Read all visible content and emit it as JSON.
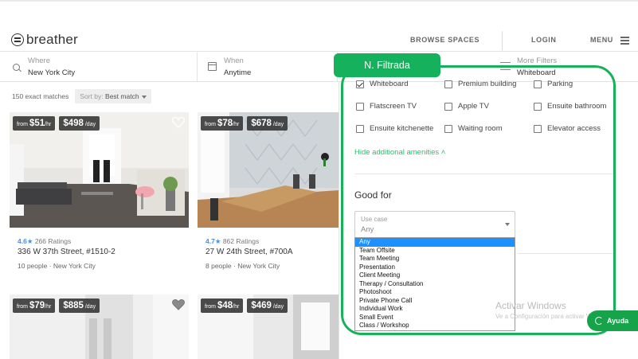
{
  "header": {
    "logo": "breather",
    "nav": [
      "BROWSE SPACES",
      "LOGIN",
      "MENU"
    ]
  },
  "filters": {
    "where_label": "Where",
    "where_value": "New York City",
    "when_label": "When",
    "when_value": "Anytime",
    "more_label": "More Filters",
    "more_value": "Whiteboard"
  },
  "results": {
    "count": "150 exact matches",
    "sort_label": "Sort by:",
    "sort_value": "Best match",
    "cards": [
      {
        "from": "from",
        "hourly": "$51",
        "hourly_unit": "/hr",
        "daily": "$498",
        "daily_unit": "/day",
        "rating": "4.6",
        "ratings": "266 Ratings",
        "address": "336 W 37th Street, #1510-2",
        "people": "10 people",
        "city": "New York City"
      },
      {
        "from": "from",
        "hourly": "$78",
        "hourly_unit": "/hr",
        "daily": "$678",
        "daily_unit": "/day",
        "rating": "4.7",
        "ratings": "862 Ratings",
        "address": "27 W 24th Street, #700A",
        "people": "8 people",
        "city": "New York City"
      },
      {
        "from": "from",
        "hourly": "$79",
        "hourly_unit": "/hr",
        "daily": "$885",
        "daily_unit": "/day"
      },
      {
        "from": "from",
        "hourly": "$48",
        "hourly_unit": "/hr",
        "daily": "$469",
        "daily_unit": "/day"
      }
    ]
  },
  "amenities": [
    {
      "label": "Whiteboard",
      "checked": true
    },
    {
      "label": "Premium building",
      "checked": false
    },
    {
      "label": "Parking",
      "checked": false
    },
    {
      "label": "Flatscreen TV",
      "checked": false
    },
    {
      "label": "Apple TV",
      "checked": false
    },
    {
      "label": "Ensuite bathroom",
      "checked": false
    },
    {
      "label": "Ensuite kitchenette",
      "checked": false
    },
    {
      "label": "Waiting room",
      "checked": false
    },
    {
      "label": "Elevator access",
      "checked": false
    }
  ],
  "hide_amenities": "Hide additional amenities",
  "good_for": {
    "heading": "Good for",
    "select_label": "Use case",
    "select_value": "Any",
    "options": [
      "Any",
      "Team Offsite",
      "Team Meeting",
      "Presentation",
      "Client Meeting",
      "Therapy / Consultation",
      "Photoshoot",
      "Private Phone Call",
      "Individual Work",
      "Small Event",
      "Class / Workshop"
    ],
    "selected_option": "Any"
  },
  "overlay": {
    "annotation": "N. Filtrada",
    "watermark_title": "Activar Windows",
    "watermark_sub": "Ve a Configuración para activar Windows.",
    "help": "Ayuda"
  },
  "colors": {
    "accent_green": "#2dbb6c",
    "annotation_green": "#16b15c",
    "rating_blue": "#4a90e2",
    "option_highlight": "#1e90ff"
  }
}
